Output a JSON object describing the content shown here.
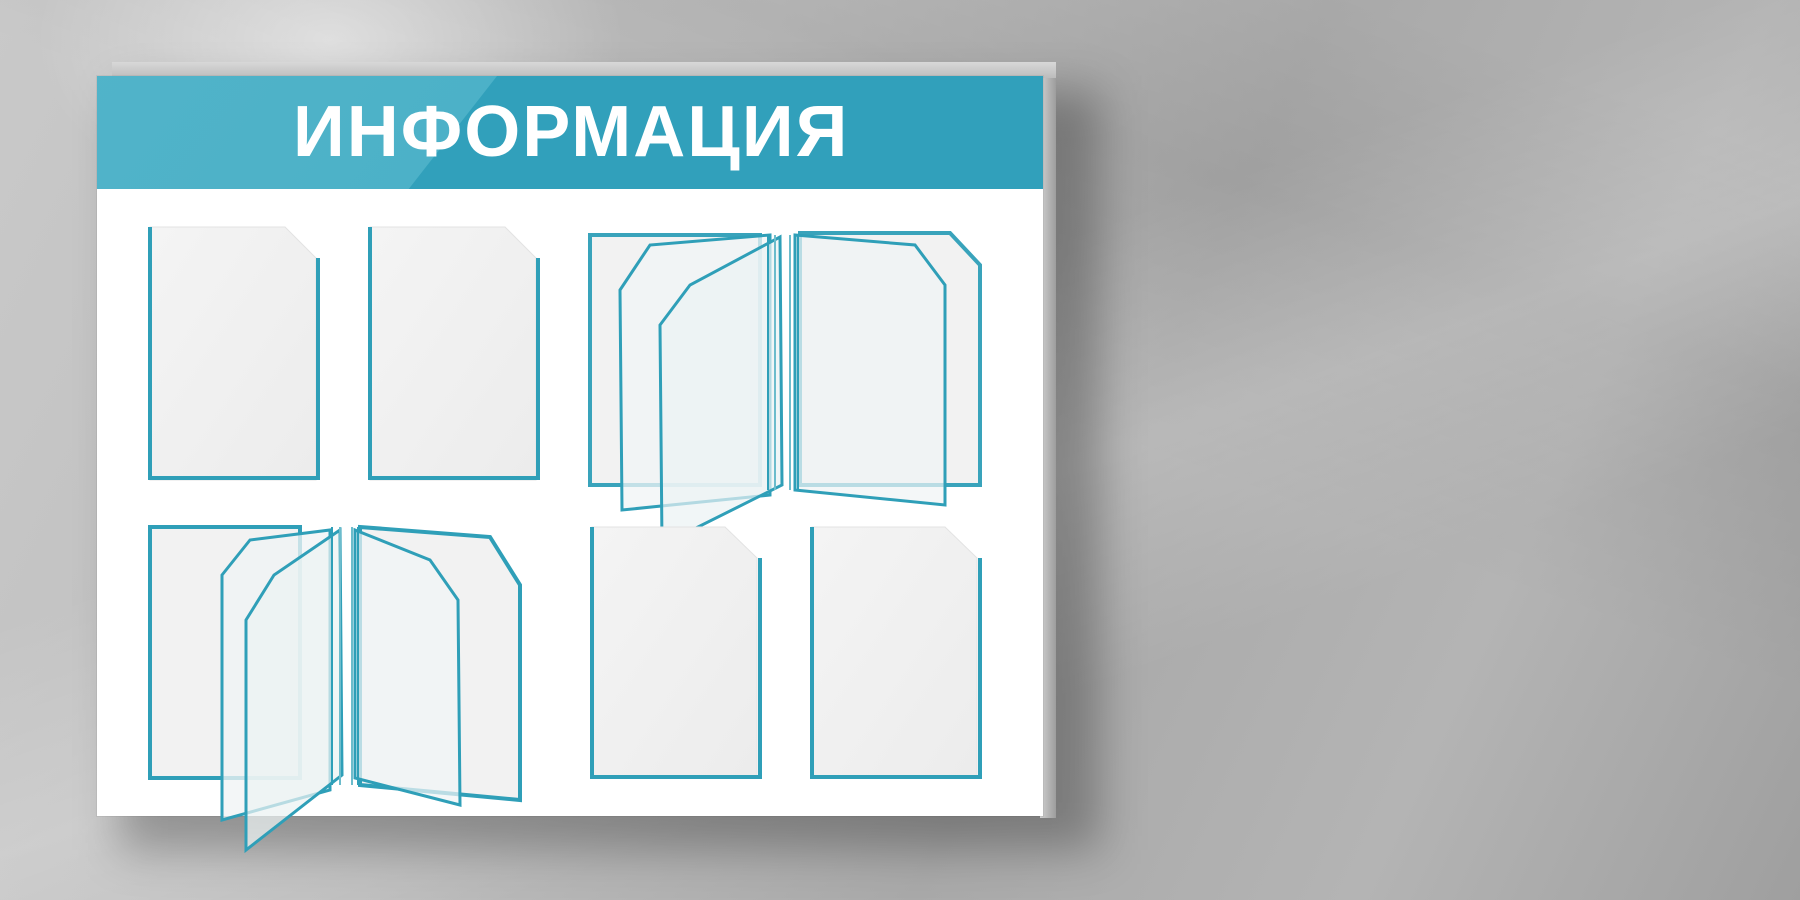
{
  "board": {
    "title": "ИНФОРМАЦИЯ",
    "accent_color": "#31a0bb",
    "pockets": [
      {
        "name": "pocket-top-1",
        "type": "single"
      },
      {
        "name": "pocket-top-2",
        "type": "single"
      },
      {
        "name": "flip-pocket-top",
        "type": "flip-book"
      },
      {
        "name": "flip-pocket-bottom",
        "type": "flip-book"
      },
      {
        "name": "pocket-bottom-3",
        "type": "single"
      },
      {
        "name": "pocket-bottom-4",
        "type": "single"
      }
    ]
  }
}
